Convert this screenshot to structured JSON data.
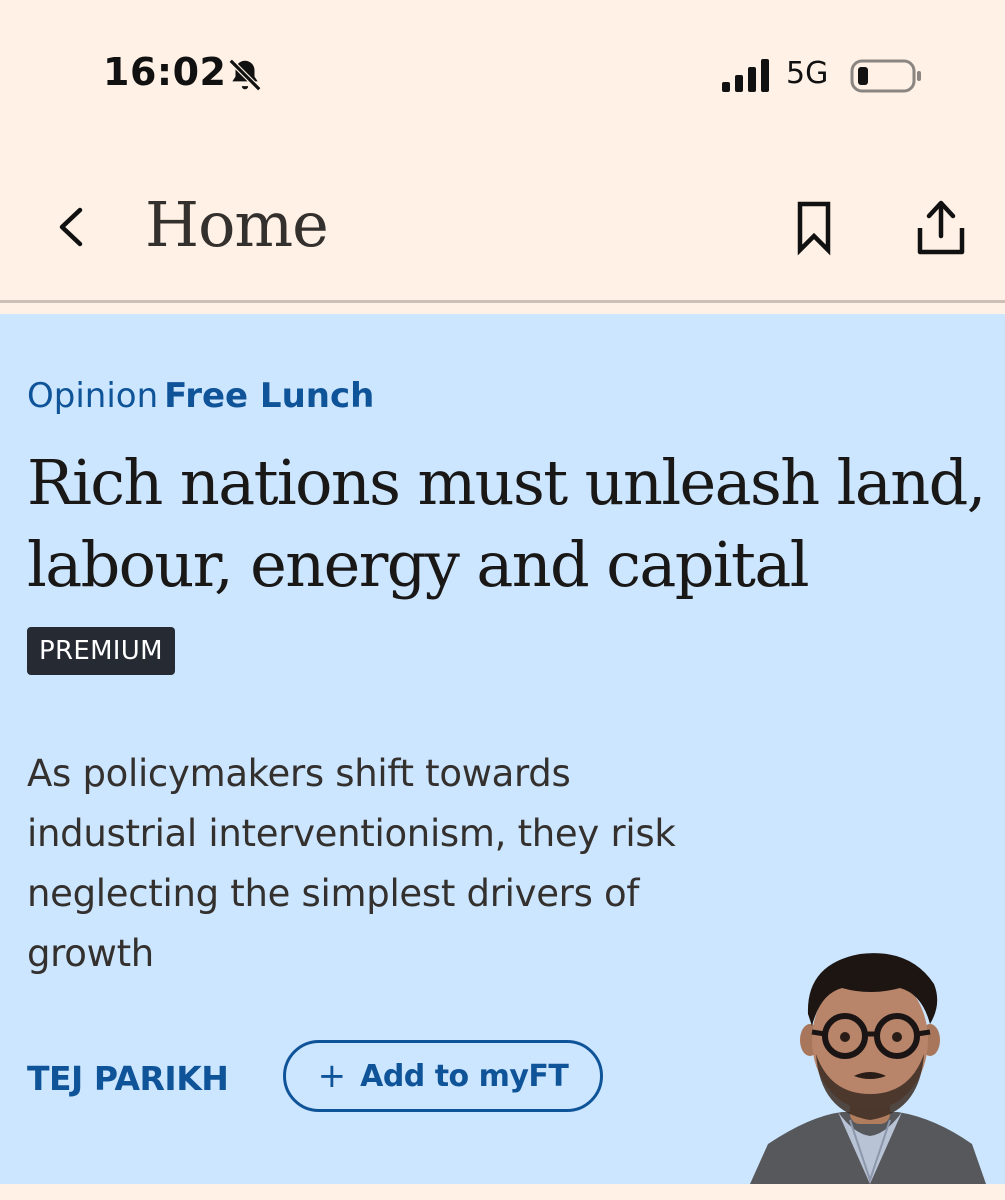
{
  "status_bar": {
    "time": "16:02",
    "network": "5G",
    "icons": [
      "bell-slash-icon",
      "signal-icon",
      "battery-icon"
    ]
  },
  "nav": {
    "title": "Home",
    "icons": [
      "chevron-left-icon",
      "bookmark-icon",
      "share-icon"
    ]
  },
  "article": {
    "genre": "Opinion",
    "series": "Free Lunch",
    "headline": "Rich nations must unleash land, labour, energy and capital",
    "badge": "PREMIUM",
    "standfirst": "As policymakers shift towards industrial interventionism, they risk neglecting the simplest drivers of growth",
    "author": "TEJ PARIKH",
    "myft_button": "Add to myFT",
    "myft_icon": "plus-icon"
  },
  "colors": {
    "page_background": "#fff1e5",
    "card_background": "#cce6ff",
    "accent": "#0f5499",
    "badge_background": "#262a33"
  }
}
